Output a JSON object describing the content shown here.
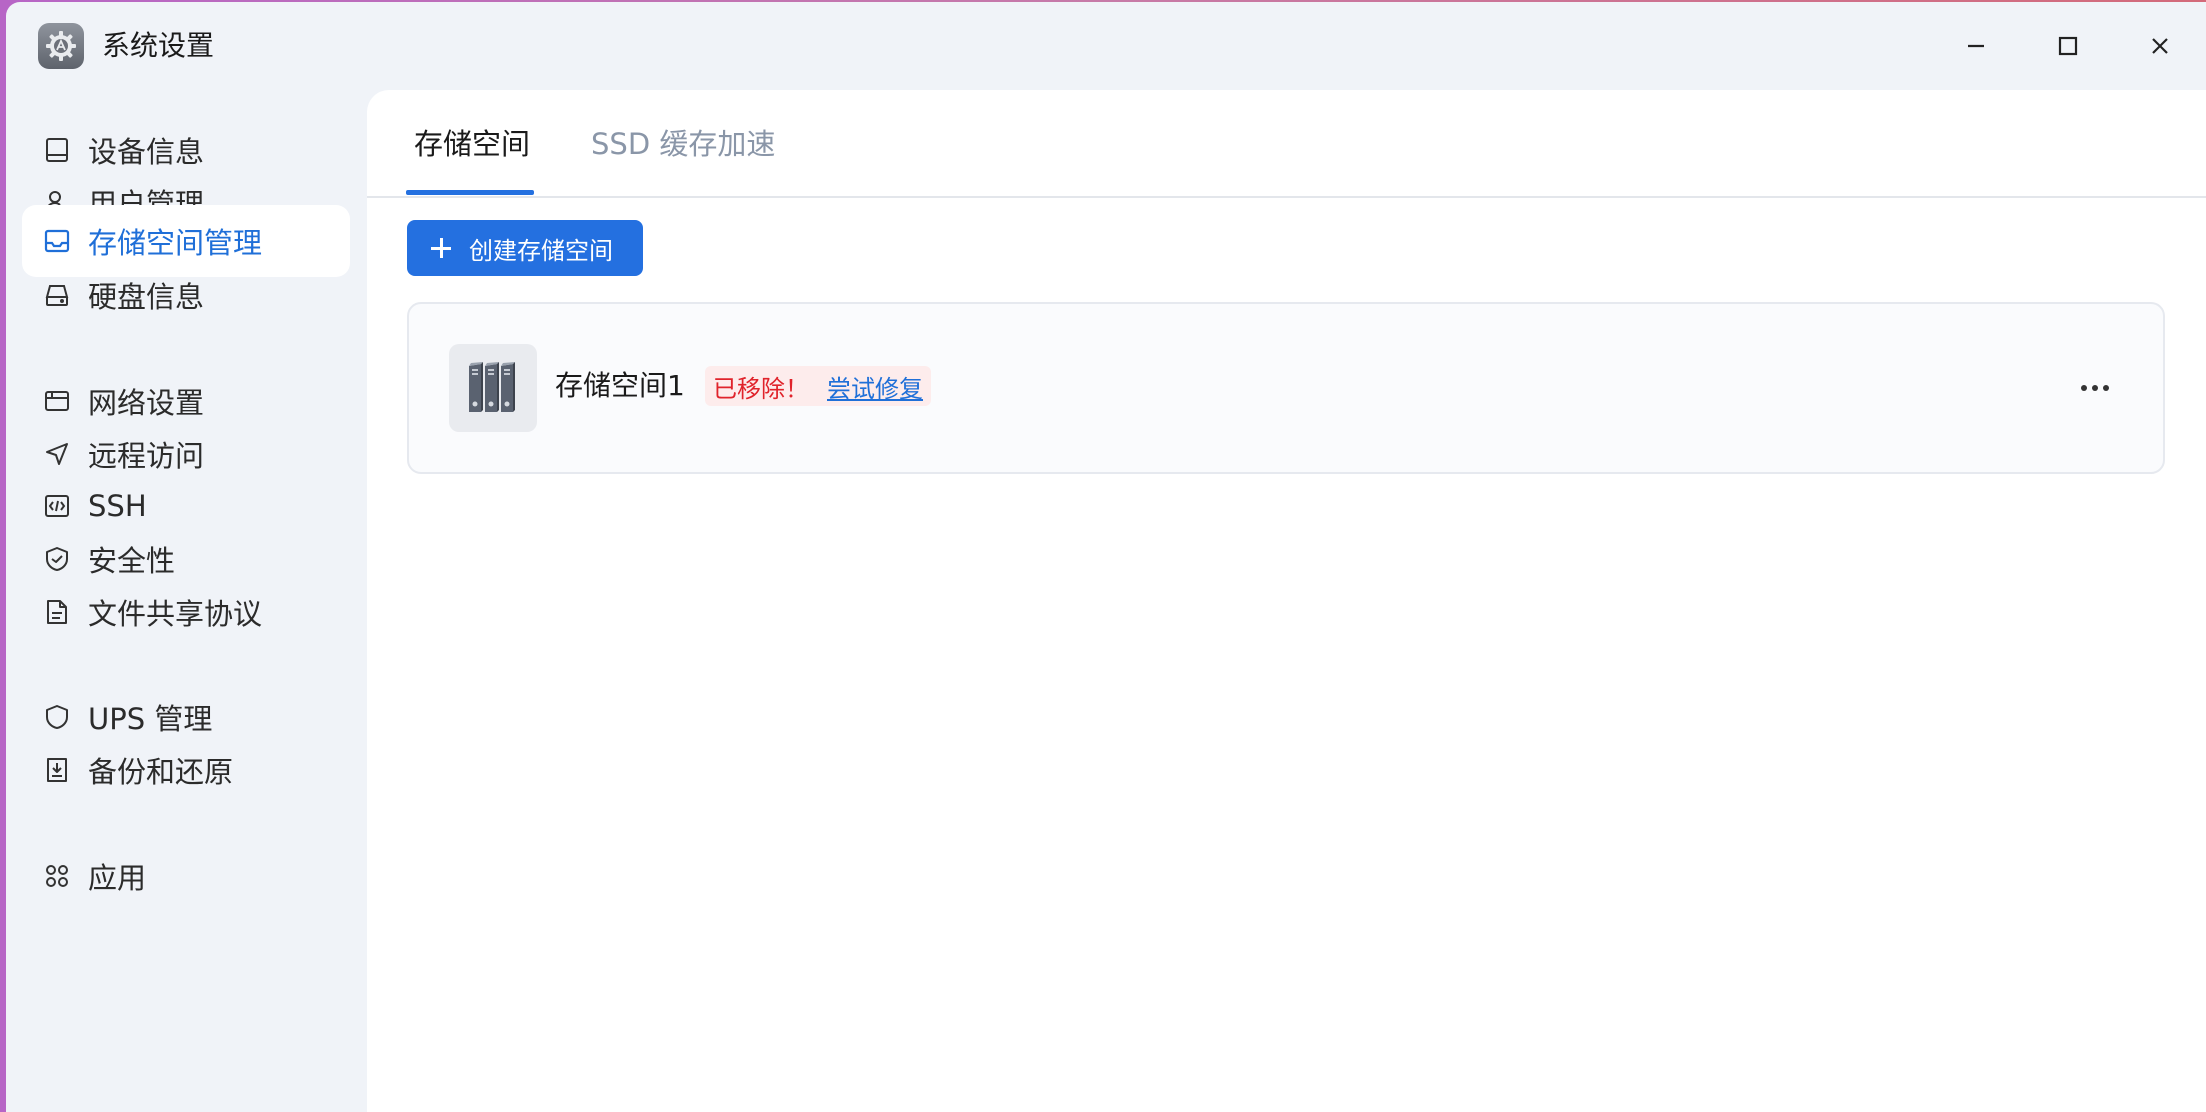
{
  "window": {
    "title": "系统设置",
    "app_icon": "settings-gear-icon"
  },
  "sidebar": {
    "items": [
      {
        "label": "设备信息",
        "icon": "device-info-icon"
      },
      {
        "label": "用户管理",
        "icon": "user-manage-icon"
      },
      {
        "label": "存储空间管理",
        "icon": "storage-manage-icon",
        "active": true
      },
      {
        "label": "硬盘信息",
        "icon": "hard-disk-icon"
      },
      {
        "label": "网络设置",
        "icon": "network-icon"
      },
      {
        "label": "远程访问",
        "icon": "remote-access-icon"
      },
      {
        "label": "SSH",
        "icon": "ssh-code-icon"
      },
      {
        "label": "安全性",
        "icon": "security-shield-icon"
      },
      {
        "label": "文件共享协议",
        "icon": "file-share-icon"
      },
      {
        "label": "UPS 管理",
        "icon": "ups-shield-icon"
      },
      {
        "label": "备份和还原",
        "icon": "backup-restore-icon"
      },
      {
        "label": "应用",
        "icon": "apps-icon"
      }
    ]
  },
  "main": {
    "tabs": [
      {
        "label": "存储空间",
        "active": true
      },
      {
        "label": "SSD 缓存加速",
        "active": false
      }
    ],
    "create_button_label": "创建存储空间",
    "pool": {
      "name": "存储空间1",
      "status": "已移除！",
      "repair_label": "尝试修复",
      "icon": "storage-pool-icon"
    }
  },
  "colors": {
    "accent": "#2470e0",
    "error": "#e0232b",
    "sidebar_bg": "#f0f3f8"
  }
}
